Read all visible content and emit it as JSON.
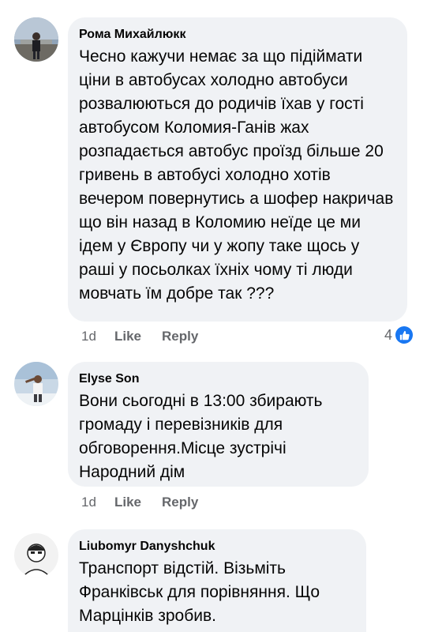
{
  "comments": [
    {
      "author": "Рома Михайлюкк",
      "text": "Чесно кажучи немає за що підіймати ціни в автобусах холодно автобуси розвалюються  до родичів їхав у гості автобусом Коломия-Ганів жах розпадається автобус проїзд більше 20 гривень в автобусі холодно хотів вечером повернутись а шофер накричав що він назад в Коломию неїде це ми ідем у Європу чи у жопу таке щось у раші у посьолках їхніх чому ті люди мовчать їм добре так ???",
      "time": "1d",
      "like_label": "Like",
      "reply_label": "Reply",
      "reaction_count": "4",
      "reaction_icon": "like-icon"
    },
    {
      "author": "Elyse Son",
      "text": "Вони сьогодні в 13:00 збирають громаду і перевізників для обговорення.Місце зустрічі Народний дім",
      "time": "1d",
      "like_label": "Like",
      "reply_label": "Reply"
    },
    {
      "author": "Liubomyr Danyshchuk",
      "text": "Транспорт відстій. Візьміть Франківськ для порівняння. Що Марцінків зробив."
    }
  ],
  "colors": {
    "bubble": "#f0f2f5",
    "meta": "#65676b",
    "like_blue": "#1877f2"
  }
}
